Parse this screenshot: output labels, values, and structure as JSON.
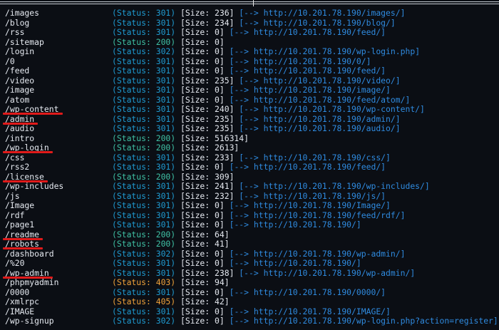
{
  "terminal": {
    "background_color": "#0b0e14",
    "status_colors": {
      "200": "#3fc1a5",
      "301": "#1f9bd1",
      "302": "#1f9bd1",
      "403": "#f0a23a",
      "405": "#f0a23a"
    },
    "highlight_color": "#e01a1a",
    "lines": [
      {
        "path": "/images",
        "status": "(Status: 301)",
        "code": "301",
        "size": "[Size: 236]",
        "redirect": "[--> http://10.201.78.190/images/]",
        "highlight": false
      },
      {
        "path": "/blog",
        "status": "(Status: 301)",
        "code": "301",
        "size": "[Size: 234]",
        "redirect": "[--> http://10.201.78.190/blog/]",
        "highlight": false
      },
      {
        "path": "/rss",
        "status": "(Status: 301)",
        "code": "301",
        "size": "[Size: 0]",
        "redirect": "[--> http://10.201.78.190/feed/]",
        "highlight": false
      },
      {
        "path": "/sitemap",
        "status": "(Status: 200)",
        "code": "200",
        "size": "[Size: 0]",
        "redirect": "",
        "highlight": false
      },
      {
        "path": "/login",
        "status": "(Status: 302)",
        "code": "302",
        "size": "[Size: 0]",
        "redirect": "[--> http://10.201.78.190/wp-login.php]",
        "highlight": false
      },
      {
        "path": "/0",
        "status": "(Status: 301)",
        "code": "301",
        "size": "[Size: 0]",
        "redirect": "[--> http://10.201.78.190/0/]",
        "highlight": false
      },
      {
        "path": "/feed",
        "status": "(Status: 301)",
        "code": "301",
        "size": "[Size: 0]",
        "redirect": "[--> http://10.201.78.190/feed/]",
        "highlight": false
      },
      {
        "path": "/video",
        "status": "(Status: 301)",
        "code": "301",
        "size": "[Size: 235]",
        "redirect": "[--> http://10.201.78.190/video/]",
        "highlight": false
      },
      {
        "path": "/image",
        "status": "(Status: 301)",
        "code": "301",
        "size": "[Size: 0]",
        "redirect": "[--> http://10.201.78.190/image/]",
        "highlight": false
      },
      {
        "path": "/atom",
        "status": "(Status: 301)",
        "code": "301",
        "size": "[Size: 0]",
        "redirect": "[--> http://10.201.78.190/feed/atom/]",
        "highlight": false
      },
      {
        "path": "/wp-content",
        "status": "(Status: 301)",
        "code": "301",
        "size": "[Size: 240]",
        "redirect": "[--> http://10.201.78.190/wp-content/]",
        "highlight": true
      },
      {
        "path": "/admin",
        "status": "(Status: 301)",
        "code": "301",
        "size": "[Size: 235]",
        "redirect": "[--> http://10.201.78.190/admin/]",
        "highlight": true
      },
      {
        "path": "/audio",
        "status": "(Status: 301)",
        "code": "301",
        "size": "[Size: 235]",
        "redirect": "[--> http://10.201.78.190/audio/]",
        "highlight": false
      },
      {
        "path": "/intro",
        "status": "(Status: 200)",
        "code": "200",
        "size": "[Size: 516314]",
        "redirect": "",
        "highlight": false
      },
      {
        "path": "/wp-login",
        "status": "(Status: 200)",
        "code": "200",
        "size": "[Size: 2613]",
        "redirect": "",
        "highlight": true
      },
      {
        "path": "/css",
        "status": "(Status: 301)",
        "code": "301",
        "size": "[Size: 233]",
        "redirect": "[--> http://10.201.78.190/css/]",
        "highlight": false
      },
      {
        "path": "/rss2",
        "status": "(Status: 301)",
        "code": "301",
        "size": "[Size: 0]",
        "redirect": "[--> http://10.201.78.190/feed/]",
        "highlight": false
      },
      {
        "path": "/license",
        "status": "(Status: 200)",
        "code": "200",
        "size": "[Size: 309]",
        "redirect": "",
        "highlight": true
      },
      {
        "path": "/wp-includes",
        "status": "(Status: 301)",
        "code": "301",
        "size": "[Size: 241]",
        "redirect": "[--> http://10.201.78.190/wp-includes/]",
        "highlight": false
      },
      {
        "path": "/js",
        "status": "(Status: 301)",
        "code": "301",
        "size": "[Size: 232]",
        "redirect": "[--> http://10.201.78.190/js/]",
        "highlight": false
      },
      {
        "path": "/Image",
        "status": "(Status: 301)",
        "code": "301",
        "size": "[Size: 0]",
        "redirect": "[--> http://10.201.78.190/Image/]",
        "highlight": false
      },
      {
        "path": "/rdf",
        "status": "(Status: 301)",
        "code": "301",
        "size": "[Size: 0]",
        "redirect": "[--> http://10.201.78.190/feed/rdf/]",
        "highlight": false
      },
      {
        "path": "/page1",
        "status": "(Status: 301)",
        "code": "301",
        "size": "[Size: 0]",
        "redirect": "[--> http://10.201.78.190/]",
        "highlight": false
      },
      {
        "path": "/readme",
        "status": "(Status: 200)",
        "code": "200",
        "size": "[Size: 64]",
        "redirect": "",
        "highlight": true
      },
      {
        "path": "/robots",
        "status": "(Status: 200)",
        "code": "200",
        "size": "[Size: 41]",
        "redirect": "",
        "highlight": true
      },
      {
        "path": "/dashboard",
        "status": "(Status: 302)",
        "code": "302",
        "size": "[Size: 0]",
        "redirect": "[--> http://10.201.78.190/wp-admin/]",
        "highlight": false
      },
      {
        "path": "/%20",
        "status": "(Status: 301)",
        "code": "301",
        "size": "[Size: 0]",
        "redirect": "[--> http://10.201.78.190/]",
        "highlight": false
      },
      {
        "path": "/wp-admin",
        "status": "(Status: 301)",
        "code": "301",
        "size": "[Size: 238]",
        "redirect": "[--> http://10.201.78.190/wp-admin/]",
        "highlight": true
      },
      {
        "path": "/phpmyadmin",
        "status": "(Status: 403)",
        "code": "403",
        "size": "[Size: 94]",
        "redirect": "",
        "highlight": false
      },
      {
        "path": "/0000",
        "status": "(Status: 301)",
        "code": "301",
        "size": "[Size: 0]",
        "redirect": "[--> http://10.201.78.190/0000/]",
        "highlight": false
      },
      {
        "path": "/xmlrpc",
        "status": "(Status: 405)",
        "code": "405",
        "size": "[Size: 42]",
        "redirect": "",
        "highlight": false
      },
      {
        "path": "/IMAGE",
        "status": "(Status: 301)",
        "code": "301",
        "size": "[Size: 0]",
        "redirect": "[--> http://10.201.78.190/IMAGE/]",
        "highlight": false
      },
      {
        "path": "/wp-signup",
        "status": "(Status: 302)",
        "code": "302",
        "size": "[Size: 0]",
        "redirect": "[--> http://10.201.78.190/wp-login.php?action=register]",
        "highlight": false
      }
    ]
  }
}
